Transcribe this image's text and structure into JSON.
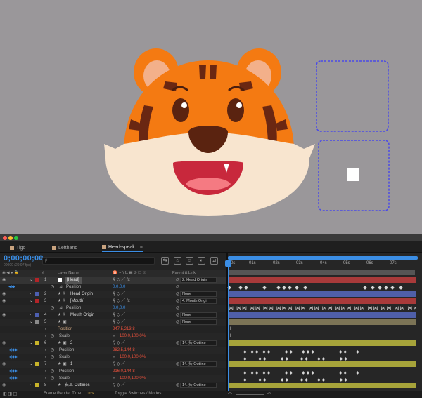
{
  "window": {
    "lights": [
      "#ff5f57",
      "#ffbd2e",
      "#28c840"
    ]
  },
  "tabs": [
    {
      "label": "Tigo",
      "color": "#c9a37f",
      "active": false
    },
    {
      "label": "Lefthand",
      "color": "#c9a37f",
      "active": false
    },
    {
      "label": "Head-speak",
      "color": "#c9a37f",
      "active": true
    }
  ],
  "timecode": "0;00;00;00",
  "fps": "00000 (29.97 fps)",
  "search_placeholder": "ρ",
  "columns": {
    "layer_name": "Layer Name",
    "switches": "♉ ✦ \\ fx ▦ ⊙ ☐ ☉",
    "parent": "Parent & Link",
    "hash": "#"
  },
  "ruler": [
    "0s",
    "01s",
    "02s",
    "03s",
    "04s",
    "05s",
    "06s",
    "07s"
  ],
  "layers": [
    {
      "num": "1",
      "name": "[Head]",
      "color": "#b32428",
      "parent": "2. Head Origin",
      "selected": true,
      "track": "#a83a3a"
    },
    {
      "prop": "Position",
      "value": "0.0,0.0",
      "valcolor": "blue"
    },
    {
      "num": "2",
      "name": "Head Origin",
      "color": "#4d5fb0",
      "parent": "None",
      "track": "#4f5fa8"
    },
    {
      "num": "3",
      "name": "[Mouth]",
      "color": "#b32428",
      "parent": "4. Mouth Origi",
      "track": "#a83a3a"
    },
    {
      "prop": "Position",
      "value": "0.0,0.0",
      "valcolor": "blue"
    },
    {
      "num": "4",
      "name": "Mouth Origin",
      "color": "#4d5fb0",
      "parent": "None",
      "track": "#4f5fa8"
    },
    {
      "num": "5",
      "name": "",
      "color": "#8a8a8a",
      "parent": "None",
      "track": "#7c7456"
    },
    {
      "prop": "Position",
      "value": "247.5,213.8",
      "valcolor": "red"
    },
    {
      "prop": "Scale",
      "value": "100.0,100.0%",
      "valcolor": "red"
    },
    {
      "num": "6",
      "name": "2",
      "color": "#c9b42a",
      "parent": "14. 头 Outline",
      "track": "#a6a33a"
    },
    {
      "prop": "Position",
      "value": "282.5,144.8",
      "valcolor": "red"
    },
    {
      "prop": "Scale",
      "value": "100.0,100.0%",
      "valcolor": "red"
    },
    {
      "num": "7",
      "name": "1",
      "color": "#c9b42a",
      "parent": "14. 头 Outline",
      "track": "#a6a33a"
    },
    {
      "prop": "Position",
      "value": "216.0,144.8",
      "valcolor": "red"
    },
    {
      "prop": "Scale",
      "value": "100.0,100.0%",
      "valcolor": "red"
    },
    {
      "num": "8",
      "name": "右耳 Outlines",
      "color": "#c9b42a",
      "parent": "14. 头 Outline",
      "track": "#a6a33a"
    }
  ],
  "status": {
    "render_label": "Frame Render Time",
    "render_value": "1ms",
    "toggle": "Toggle Switches / Modes"
  },
  "colors": {
    "tiger_orange": "#f47a12",
    "stripe": "#6a2712",
    "muzzle": "#f8e5cf",
    "selection_box": "#4a4ae8",
    "accent": "#3b8ee5"
  }
}
